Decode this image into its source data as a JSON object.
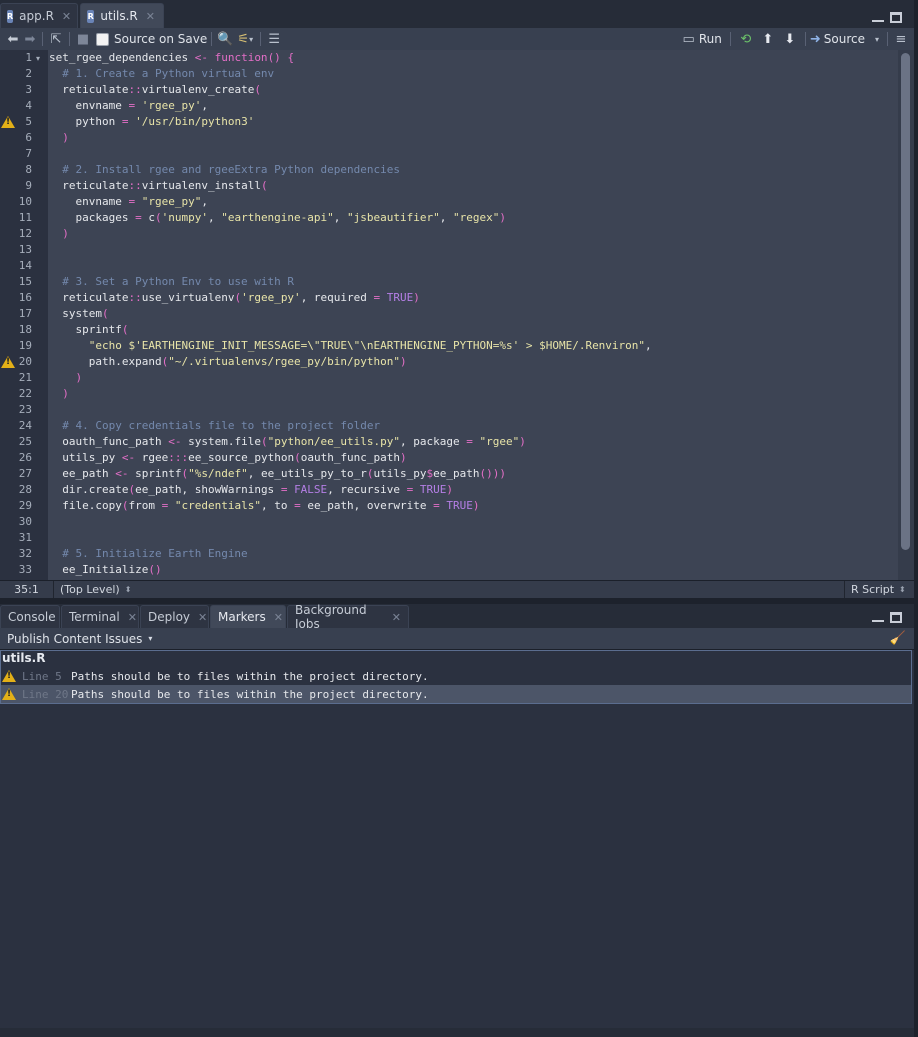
{
  "tabs": [
    {
      "label": "app.R",
      "icon": "R"
    },
    {
      "label": "utils.R",
      "icon": "R"
    }
  ],
  "toolbar": {
    "source_on_save": "Source on Save",
    "run": "Run",
    "source": "Source"
  },
  "editor": {
    "lines": [
      {
        "n": "1",
        "html": "set_rgee_dependencies <span class='op'>&lt;-</span> <span class='k'>function</span><span class='k'>()</span> <span class='k'>{</span>"
      },
      {
        "n": "2",
        "html": "  <span class='c'># 1. Create a Python virtual env</span>"
      },
      {
        "n": "3",
        "html": "  reticulate<span class='op'>::</span>virtualenv_create<span class='k'>(</span>"
      },
      {
        "n": "4",
        "html": "    envname <span class='op'>=</span> <span class='s'>'rgee_py'</span>,"
      },
      {
        "n": "5",
        "html": "    python <span class='op'>=</span> <span class='s'>'/usr/bin/python3'</span>"
      },
      {
        "n": "6",
        "html": "  <span class='k'>)</span>"
      },
      {
        "n": "7",
        "html": ""
      },
      {
        "n": "8",
        "html": "  <span class='c'># 2. Install rgee and rgeeExtra Python dependencies</span>"
      },
      {
        "n": "9",
        "html": "  reticulate<span class='op'>::</span>virtualenv_install<span class='k'>(</span>"
      },
      {
        "n": "10",
        "html": "    envname <span class='op'>=</span> <span class='s'>\"rgee_py\"</span>,"
      },
      {
        "n": "11",
        "html": "    packages <span class='op'>=</span> c<span class='k'>(</span><span class='s'>'numpy'</span>, <span class='s'>\"earthengine-api\"</span>, <span class='s'>\"jsbeautifier\"</span>, <span class='s'>\"regex\"</span><span class='k'>)</span>"
      },
      {
        "n": "12",
        "html": "  <span class='k'>)</span>"
      },
      {
        "n": "13",
        "html": ""
      },
      {
        "n": "14",
        "html": ""
      },
      {
        "n": "15",
        "html": "  <span class='c'># 3. Set a Python Env to use with R</span>"
      },
      {
        "n": "16",
        "html": "  reticulate<span class='op'>::</span>use_virtualenv<span class='k'>(</span><span class='s'>'rgee_py'</span>, required <span class='op'>=</span> <span class='b'>TRUE</span><span class='k'>)</span>"
      },
      {
        "n": "17",
        "html": "  system<span class='k'>(</span>"
      },
      {
        "n": "18",
        "html": "    sprintf<span class='k'>(</span>"
      },
      {
        "n": "19",
        "html": "      <span class='s'>\"echo $'EARTHENGINE_INIT_MESSAGE=\\\"TRUE\\\"\\nEARTHENGINE_PYTHON=%s' &gt; $HOME/.Renviron\"</span>,"
      },
      {
        "n": "20",
        "html": "      path.expand<span class='k'>(</span><span class='s'>\"~/.virtualenvs/rgee_py/bin/python\"</span><span class='k'>)</span>"
      },
      {
        "n": "21",
        "html": "    <span class='k'>)</span>"
      },
      {
        "n": "22",
        "html": "  <span class='k'>)</span>"
      },
      {
        "n": "23",
        "html": ""
      },
      {
        "n": "24",
        "html": "  <span class='c'># 4. Copy credentials file to the project folder</span>"
      },
      {
        "n": "25",
        "html": "  oauth_func_path <span class='op'>&lt;-</span> system.file<span class='k'>(</span><span class='s'>\"python/ee_utils.py\"</span>, package <span class='op'>=</span> <span class='s'>\"rgee\"</span><span class='k'>)</span>"
      },
      {
        "n": "26",
        "html": "  utils_py <span class='op'>&lt;-</span> rgee<span class='op'>:::</span>ee_source_python<span class='k'>(</span>oauth_func_path<span class='k'>)</span>"
      },
      {
        "n": "27",
        "html": "  ee_path <span class='op'>&lt;-</span> sprintf<span class='k'>(</span><span class='s'>\"%s/ndef\"</span>, ee_utils_py_to_r<span class='k'>(</span>utils_py<span class='op'>$</span>ee_path<span class='k'>()))</span>"
      },
      {
        "n": "28",
        "html": "  dir.create<span class='k'>(</span>ee_path, showWarnings <span class='op'>=</span> <span class='b'>FALSE</span>, recursive <span class='op'>=</span> <span class='b'>TRUE</span><span class='k'>)</span>"
      },
      {
        "n": "29",
        "html": "  file.copy<span class='k'>(</span>from <span class='op'>=</span> <span class='s'>\"credentials\"</span>, to <span class='op'>=</span> ee_path, overwrite <span class='op'>=</span> <span class='b'>TRUE</span><span class='k'>)</span>"
      },
      {
        "n": "30",
        "html": ""
      },
      {
        "n": "31",
        "html": ""
      },
      {
        "n": "32",
        "html": "  <span class='c'># 5. Initialize Earth Engine</span>"
      },
      {
        "n": "33",
        "html": "  ee_Initialize<span class='k'>()</span>"
      }
    ],
    "warning_lines": [
      "5",
      "20"
    ]
  },
  "statusbar": {
    "position": "35:1",
    "scope": "(Top Level)",
    "filetype": "R Script"
  },
  "bottom_tabs": [
    "Console",
    "Terminal",
    "Deploy",
    "Markers",
    "Background Jobs"
  ],
  "markers": {
    "dropdown": "Publish Content Issues",
    "file": "utils.R",
    "items": [
      {
        "line": "Line 5",
        "message": "Paths should be to files within the project directory."
      },
      {
        "line": "Line 20",
        "message": "Paths should be to files within the project directory."
      }
    ]
  }
}
